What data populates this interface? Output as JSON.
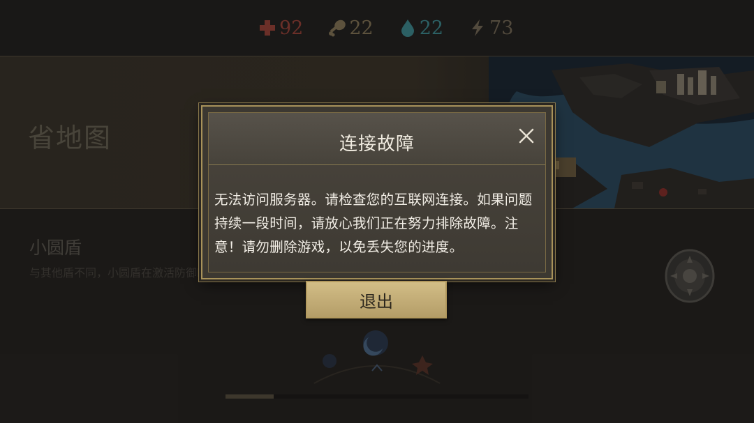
{
  "resources": [
    {
      "name": "health",
      "value": "92",
      "color": "#a0443a",
      "icon": "red-cross-icon"
    },
    {
      "name": "food",
      "value": "22",
      "color": "#8a7a5a",
      "icon": "drumstick-icon"
    },
    {
      "name": "water",
      "value": "22",
      "color": "#3f8f95",
      "icon": "water-drop-icon"
    },
    {
      "name": "energy",
      "value": "73",
      "color": "#7a6e5a",
      "icon": "lightning-icon"
    }
  ],
  "banner": {
    "title": "省地图"
  },
  "item": {
    "name": "小圆盾",
    "description": "与其他盾不同，小圆盾在激活防御时保护自己的所有身体部位，但防御效果更加有限。"
  },
  "dialog": {
    "title": "连接故障",
    "message": "无法访问服务器。请检查您的互联网连接。如果问题持续一段时间，请放心我们正在努力排除故障。注意！请勿删除游戏，以免丢失您的进度。",
    "exit_label": "退出"
  },
  "progress": {
    "value": 0.16
  },
  "colors": {
    "accent": "#b39a5f",
    "dialog_bg": "#3c3831"
  }
}
